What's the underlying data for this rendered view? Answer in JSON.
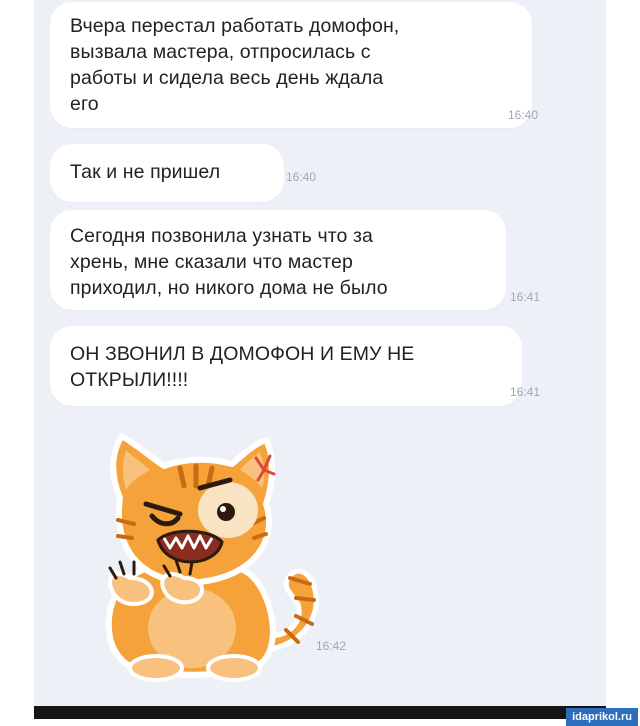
{
  "messages": [
    {
      "text": "Вчера перестал работать домофон,\nвызвала мастера, отпросилась с\nработы и сидела весь день ждала\nего",
      "time": "16:40"
    },
    {
      "text": "Так и не пришел",
      "time": "16:40"
    },
    {
      "text": "Сегодня позвонила узнать что за\nхрень, мне сказали что мастер\nприходил, но никого дома не было",
      "time": "16:41"
    },
    {
      "text": "ОН ЗВОНИЛ В ДОМОФОН И ЕМУ НЕ\nОТКРЫЛИ!!!!",
      "time": "16:41"
    }
  ],
  "sticker": {
    "icon": "angry-cat-sticker-icon",
    "time": "16:42"
  },
  "watermark": "idaprikol.ru",
  "colors": {
    "chat_background": "#eef0f7",
    "bubble": "#ffffff",
    "timestamp": "#a0a6b3",
    "cat_orange": "#f5a23a",
    "watermark_bg": "#2a6ebd"
  }
}
